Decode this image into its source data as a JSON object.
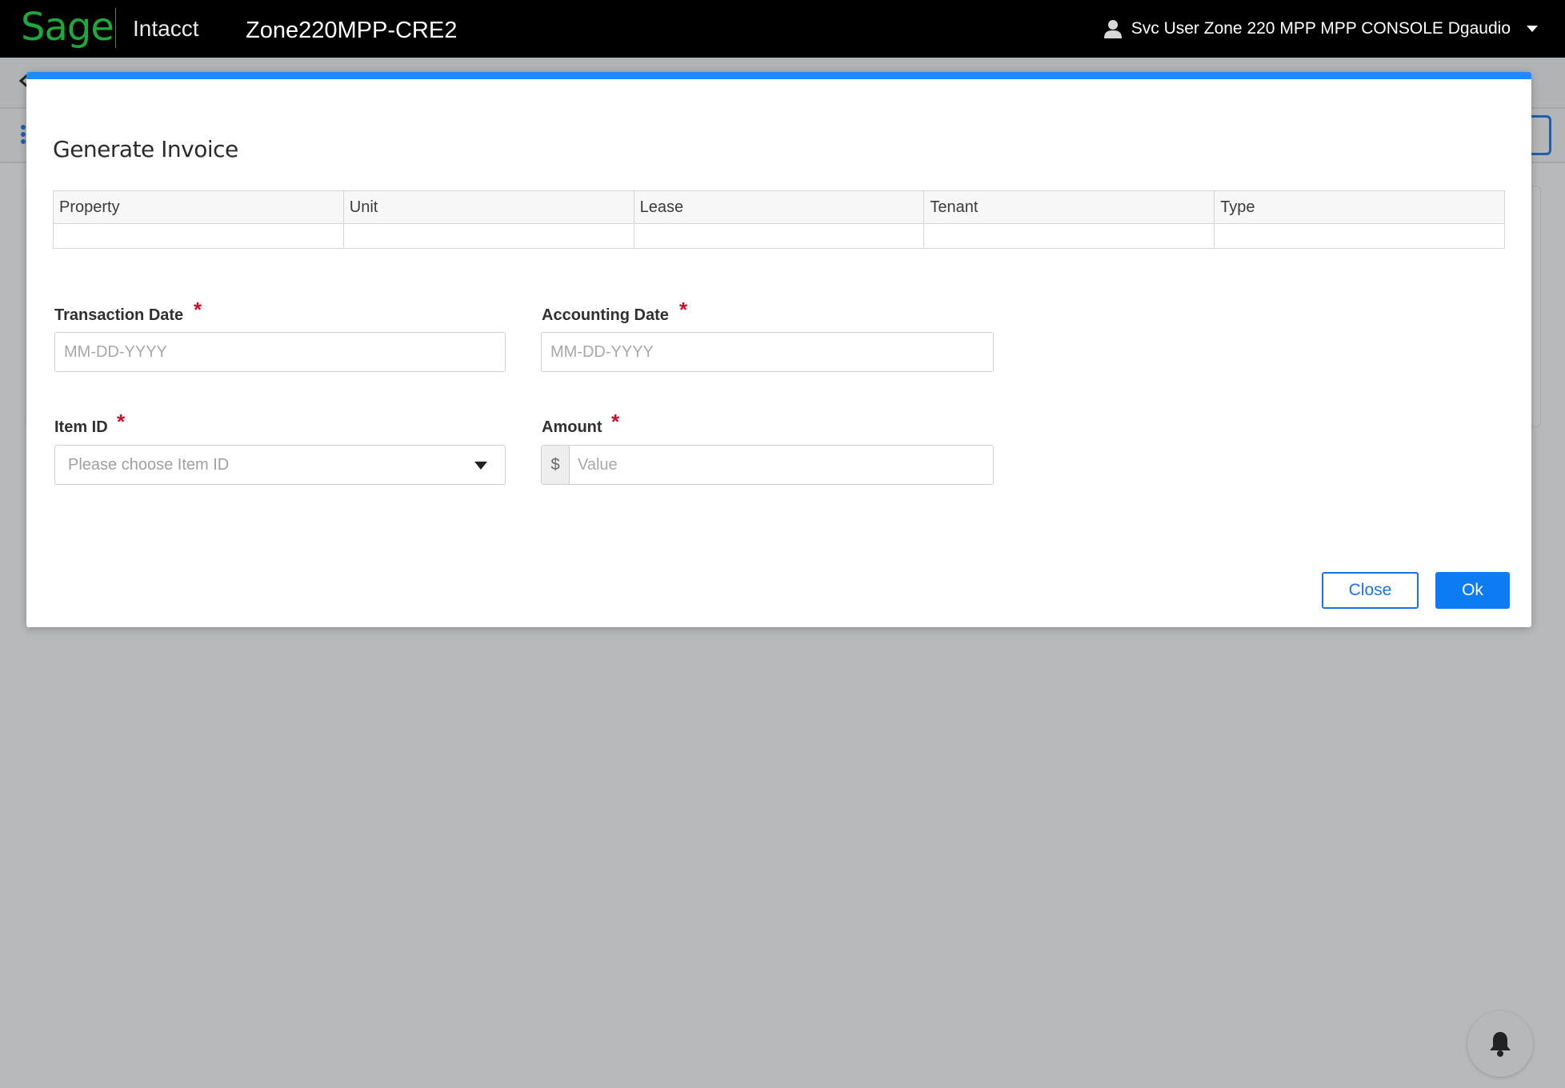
{
  "header": {
    "logo_text": "Sage",
    "product": "Intacct",
    "company": "Zone220MPP-CRE2",
    "user": "Svc User Zone 220 MPP MPP CONSOLE Dgaudio"
  },
  "modal": {
    "title": "Generate Invoice",
    "table": {
      "columns": [
        "Property",
        "Unit",
        "Lease",
        "Tenant",
        "Type"
      ],
      "rows": [
        [
          "",
          "",
          "",
          "",
          ""
        ]
      ]
    },
    "fields": {
      "transaction_date": {
        "label": "Transaction Date",
        "required": "*",
        "placeholder": "MM-DD-YYYY",
        "value": ""
      },
      "accounting_date": {
        "label": "Accounting Date",
        "required": "*",
        "placeholder": "MM-DD-YYYY",
        "value": ""
      },
      "item_id": {
        "label": "Item ID",
        "required": "*",
        "placeholder": "Please choose Item ID"
      },
      "amount": {
        "label": "Amount",
        "required": "*",
        "currency": "$",
        "placeholder": "Value",
        "value": ""
      }
    },
    "buttons": {
      "close": "Close",
      "ok": "Ok"
    }
  },
  "icons": {
    "user": "user-icon",
    "caret": "caret-down-icon",
    "select_arrow": "chevron-down-icon",
    "notification": "bell-icon"
  },
  "colors": {
    "brand_green": "#1fa83b",
    "accent_blue": "#1a8cff",
    "primary_button": "#0d7cf2",
    "required_red": "#c8102e"
  }
}
